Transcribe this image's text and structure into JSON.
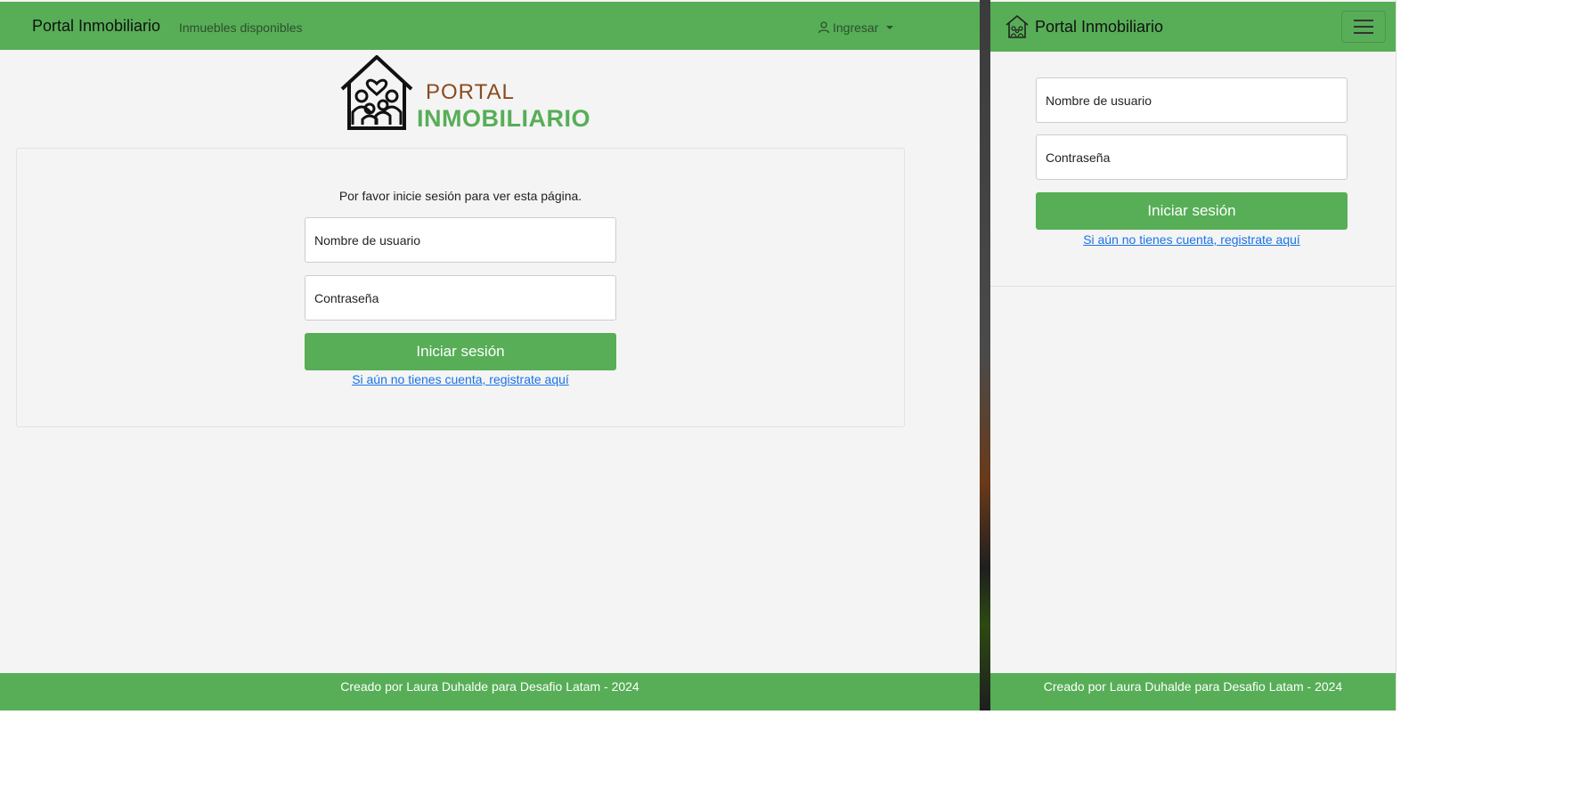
{
  "left_window": {
    "navbar": {
      "brand": "Portal Inmobiliario",
      "link": "Inmuebles disponibles",
      "login_menu": "Ingresar"
    },
    "logo": {
      "line1": "PORTAL",
      "line2": "INMOBILIARIO"
    },
    "login_card": {
      "message": "Por favor inicie sesión para ver esta página.",
      "username_placeholder": "Nombre de usuario",
      "password_placeholder": "Contraseña",
      "submit_label": "Iniciar sesión",
      "register_link": "Si aún no tienes cuenta, registrate aquí"
    },
    "footer": "Creado por Laura Duhalde para Desafio Latam - 2024"
  },
  "right_window": {
    "navbar": {
      "brand": "Portal Inmobiliario",
      "brand_icon": "house-family-icon",
      "menu_toggle_icon": "hamburger-icon"
    },
    "login_form": {
      "username_placeholder": "Nombre de usuario",
      "password_placeholder": "Contraseña",
      "submit_label": "Iniciar sesión",
      "register_link": "Si aún no tienes cuenta, registrate aquí"
    },
    "footer": "Creado por Laura Duhalde para Desafio Latam - 2024"
  },
  "colors": {
    "brand_green": "#57ae57",
    "logo_brown": "#8a4b1e",
    "link_blue": "#1a73e8",
    "page_background": "#f4f4f4"
  }
}
